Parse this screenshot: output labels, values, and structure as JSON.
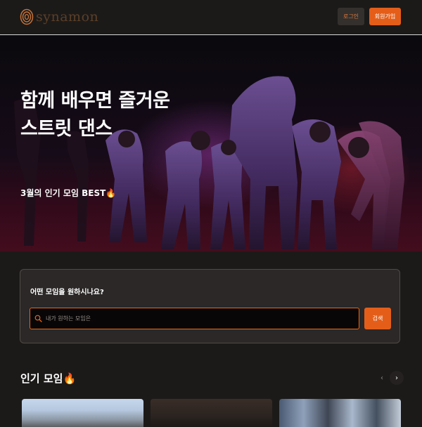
{
  "header": {
    "logo_text": "synamon",
    "login_label": "로그인",
    "signup_label": "회원가입"
  },
  "hero": {
    "title_line1": "함께 배우면 즐거운",
    "title_line2": "스트릿 댄스",
    "subtitle": "3월의 인기 모임 BEST",
    "flame": "🔥"
  },
  "search": {
    "question": "어떤 모임을 원하시나요?",
    "placeholder": "내가 원하는 모임은",
    "button_label": "검색"
  },
  "popular": {
    "title": "인기 모임",
    "flame": "🔥",
    "prev_symbol": "‹",
    "next_symbol": "›"
  },
  "colors": {
    "accent": "#e45e19",
    "background": "#1c1a19",
    "card_background": "#2b2827"
  },
  "icons": {
    "logo": "spiral-logo-icon",
    "search": "search-icon",
    "prev": "chevron-left-icon",
    "next": "chevron-right-icon"
  }
}
